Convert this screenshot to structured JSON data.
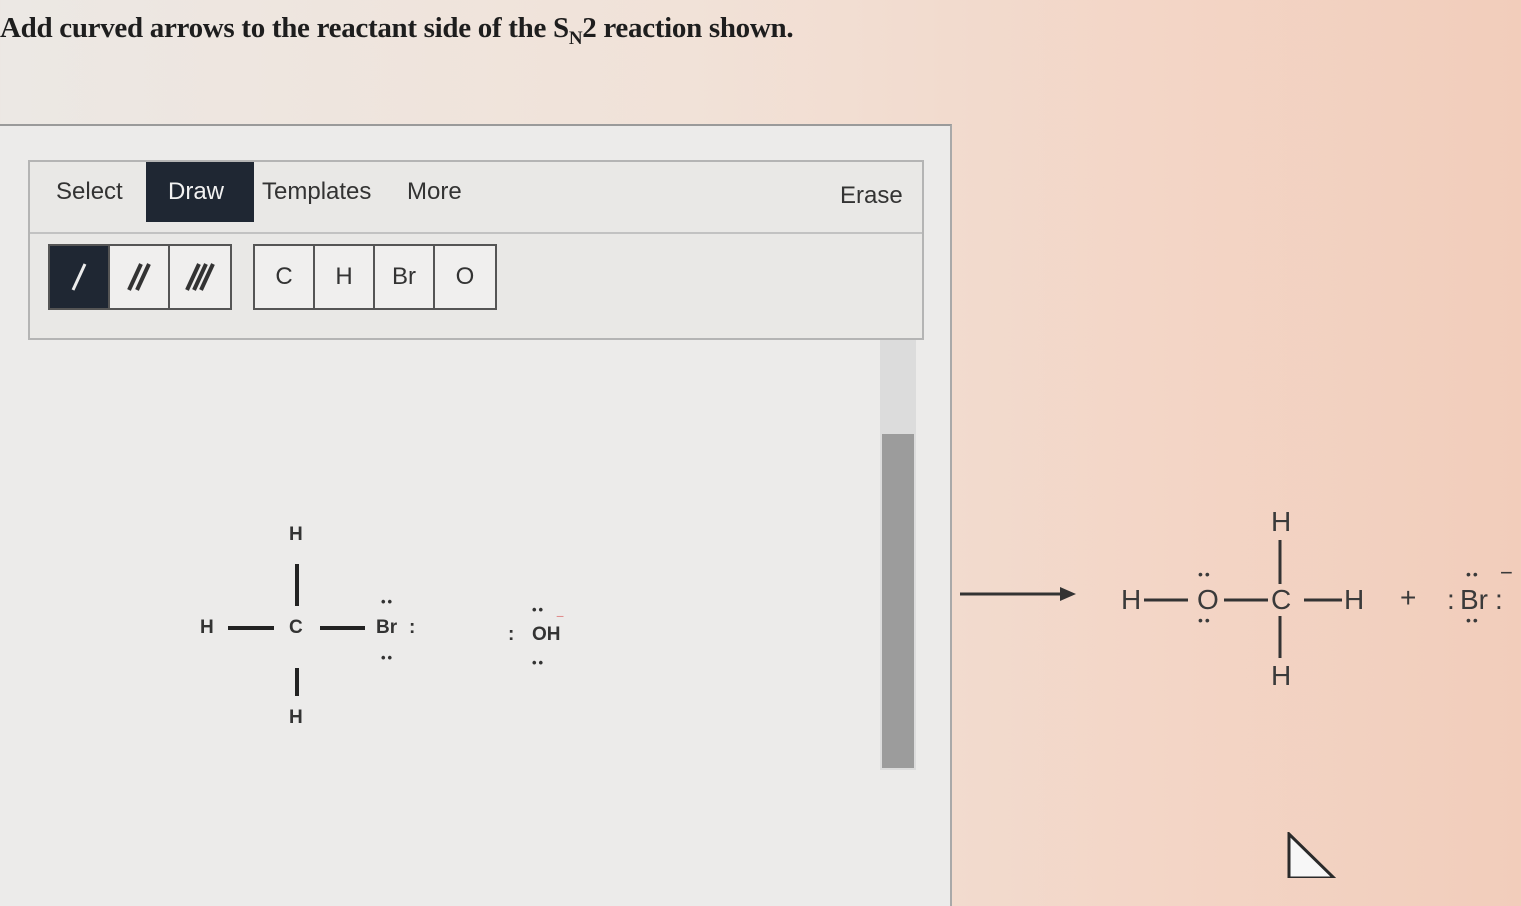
{
  "question": {
    "prefix": "Add curved arrows to the reactant side of the S",
    "subscript": "N",
    "suffix": "2 reaction shown."
  },
  "toolbar": {
    "tabs": [
      {
        "label": "Select",
        "active": false
      },
      {
        "label": "Draw",
        "active": true
      },
      {
        "label": "Templates",
        "active": false
      },
      {
        "label": "More",
        "active": false
      }
    ],
    "erase_label": "Erase",
    "bond_tools": [
      "single-bond",
      "double-bond",
      "triple-bond"
    ],
    "atoms": [
      "C",
      "H",
      "Br",
      "O"
    ]
  },
  "reactant": {
    "atoms": {
      "top_h": "H",
      "left_h": "H",
      "center_c": "C",
      "bottom_h": "H",
      "br": "Br"
    },
    "lone_pair": "••",
    "colon": ":",
    "hydroxide": "OH",
    "hydroxide_charge": "−"
  },
  "product": {
    "h_left": "H",
    "o": "O",
    "c": "C",
    "h_right": "H",
    "h_top": "H",
    "h_bottom": "H",
    "plus": "+",
    "bromide": "Br",
    "bromide_charge": "−",
    "lone_pair": "••",
    "colon": ":"
  },
  "colors": {
    "active_tab": "#1f2733",
    "border": "#555555"
  }
}
